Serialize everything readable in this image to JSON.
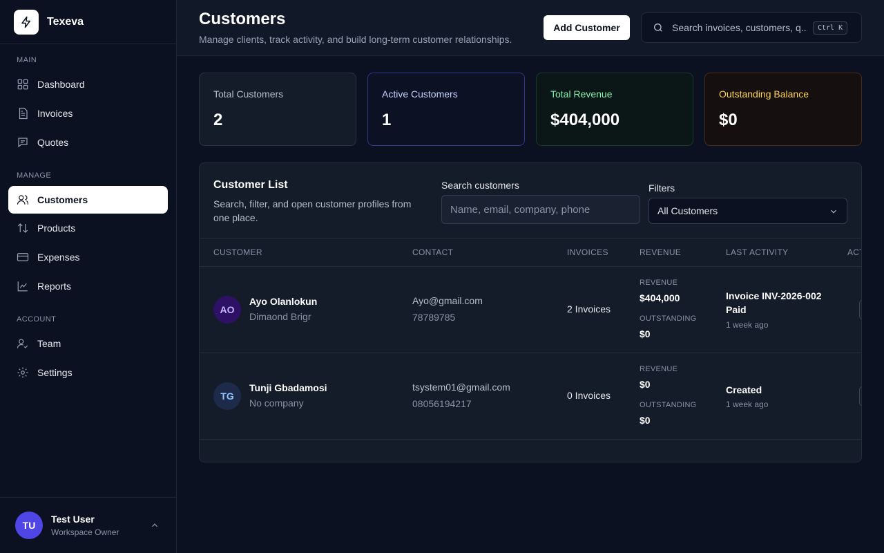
{
  "app": {
    "name": "Texeva"
  },
  "sidebar": {
    "sections": [
      "MAIN",
      "MANAGE",
      "ACCOUNT"
    ],
    "items": [
      {
        "label": "Dashboard",
        "icon": "dashboard-icon"
      },
      {
        "label": "Invoices",
        "icon": "invoice-icon"
      },
      {
        "label": "Quotes",
        "icon": "quote-icon"
      },
      {
        "label": "Customers",
        "icon": "users-icon",
        "active": true
      },
      {
        "label": "Products",
        "icon": "products-icon"
      },
      {
        "label": "Expenses",
        "icon": "card-icon"
      },
      {
        "label": "Reports",
        "icon": "chart-icon"
      },
      {
        "label": "Team",
        "icon": "team-icon"
      },
      {
        "label": "Settings",
        "icon": "gear-icon"
      }
    ],
    "user": {
      "initials": "TU",
      "name": "Test User",
      "role": "Workspace Owner"
    }
  },
  "header": {
    "title": "Customers",
    "subtitle": "Manage clients, track activity, and build long-term customer relationships.",
    "add_button": "Add Customer",
    "search_placeholder": "Search invoices, customers, q...",
    "shortcut": "Ctrl K"
  },
  "stats": [
    {
      "label": "Total Customers",
      "value": "2"
    },
    {
      "label": "Active Customers",
      "value": "1"
    },
    {
      "label": "Total Revenue",
      "value": "$404,000"
    },
    {
      "label": "Outstanding Balance",
      "value": "$0"
    }
  ],
  "customer_list": {
    "title": "Customer List",
    "description": "Search, filter, and open customer profiles from one place.",
    "search_label": "Search customers",
    "search_placeholder": "Name, email, company, phone",
    "filter_label": "Filters",
    "filter_value": "All Customers",
    "columns": [
      "CUSTOMER",
      "CONTACT",
      "INVOICES",
      "REVENUE",
      "LAST ACTIVITY",
      "ACTIONS"
    ],
    "revenue_label": "REVENUE",
    "outstanding_label": "OUTSTANDING",
    "rows": [
      {
        "initials": "AO",
        "name": "Ayo Olanlokun",
        "company": "Dimaond Brigr",
        "email": "Ayo@gmail.com",
        "phone": "78789785",
        "invoices": "2 Invoices",
        "revenue": "$404,000",
        "outstanding": "$0",
        "activity": "Invoice INV-2026-002 Paid",
        "activity_time": "1 week ago"
      },
      {
        "initials": "TG",
        "name": "Tunji Gbadamosi",
        "company": "No company",
        "email": "tsystem01@gmail.com",
        "phone": "08056194217",
        "invoices": "0 Invoices",
        "revenue": "$0",
        "outstanding": "$0",
        "activity": "Created",
        "activity_time": "1 week ago"
      }
    ]
  }
}
